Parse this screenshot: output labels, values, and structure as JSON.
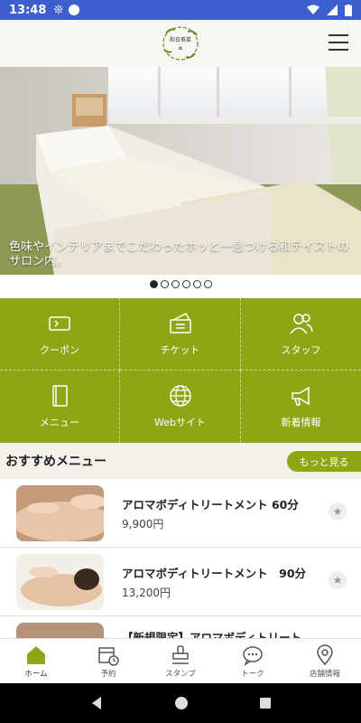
{
  "status_bar": {
    "time": "13:48"
  },
  "header": {
    "logo_text": "和日茶菜"
  },
  "hero": {
    "caption": "色味やインテリアまでこだわったホッと一息つける和テイストのサロン内。",
    "slide_count": 6,
    "active_slide": 1
  },
  "grid": {
    "items": [
      {
        "label": "クーポン",
        "icon": "coupon-icon"
      },
      {
        "label": "チケット",
        "icon": "ticket-icon"
      },
      {
        "label": "スタッフ",
        "icon": "staff-icon"
      },
      {
        "label": "メニュー",
        "icon": "menu-book-icon"
      },
      {
        "label": "Webサイト",
        "icon": "globe-icon"
      },
      {
        "label": "新着情報",
        "icon": "megaphone-icon"
      }
    ]
  },
  "recommended": {
    "title": "おすすめメニュー",
    "more_label": "もっと見る",
    "items": [
      {
        "name": "アロマボディトリートメント 60分",
        "price": "9,900円"
      },
      {
        "name": "アロマボディトリートメント　90分",
        "price": "13,200円"
      },
      {
        "name": "【新規限定】アロマボディトリート",
        "price": ""
      }
    ]
  },
  "bottom_nav": {
    "items": [
      {
        "label": "ホーム",
        "icon": "home-icon",
        "active": true
      },
      {
        "label": "予約",
        "icon": "calendar-icon",
        "active": false
      },
      {
        "label": "スタンプ",
        "icon": "stamp-icon",
        "active": false
      },
      {
        "label": "トーク",
        "icon": "chat-icon",
        "active": false
      },
      {
        "label": "店舗情報",
        "icon": "location-icon",
        "active": false
      }
    ]
  },
  "colors": {
    "accent": "#8ea514",
    "status_bar": "#3d5ecf",
    "header_bg": "#f8f6f1"
  }
}
